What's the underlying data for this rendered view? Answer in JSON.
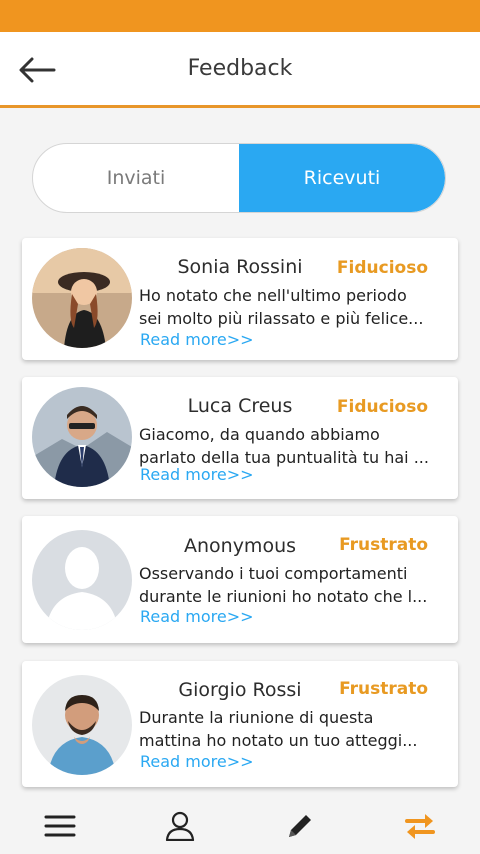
{
  "header": {
    "title": "Feedback"
  },
  "tabs": {
    "sent_label": "Inviati",
    "received_label": "Ricevuti",
    "active": "Ricevuti"
  },
  "feedbacks": [
    {
      "name": "Sonia Rossini",
      "mood": "Fiducioso",
      "line1": "Ho notato che nell'ultimo periodo",
      "line2": "sei molto più rilassato e più felice...",
      "read_more": "Read more>>"
    },
    {
      "name": "Luca Creus",
      "mood": "Fiducioso",
      "line1": "Giacomo, da quando abbiamo",
      "line2": "parlato della tua puntualità tu hai ...",
      "read_more": "Read more>>"
    },
    {
      "name": "Anonymous",
      "mood": "Frustrato",
      "line1": "Osservando i tuoi comportamenti",
      "line2": "durante le riunioni ho notato che l...",
      "read_more": "Read more>>"
    },
    {
      "name": "Giorgio Rossi",
      "mood": "Frustrato",
      "line1": "Durante la riunione di questa",
      "line2": "mattina ho notato un tuo atteggi...",
      "read_more": "Read more>>"
    }
  ],
  "nav": {
    "icons": [
      "menu-icon",
      "profile-icon",
      "edit-icon",
      "swap-icon"
    ]
  },
  "colors": {
    "accent_orange": "#f0951f",
    "accent_blue": "#2aa8f2",
    "mood_color": "#e89a22"
  }
}
